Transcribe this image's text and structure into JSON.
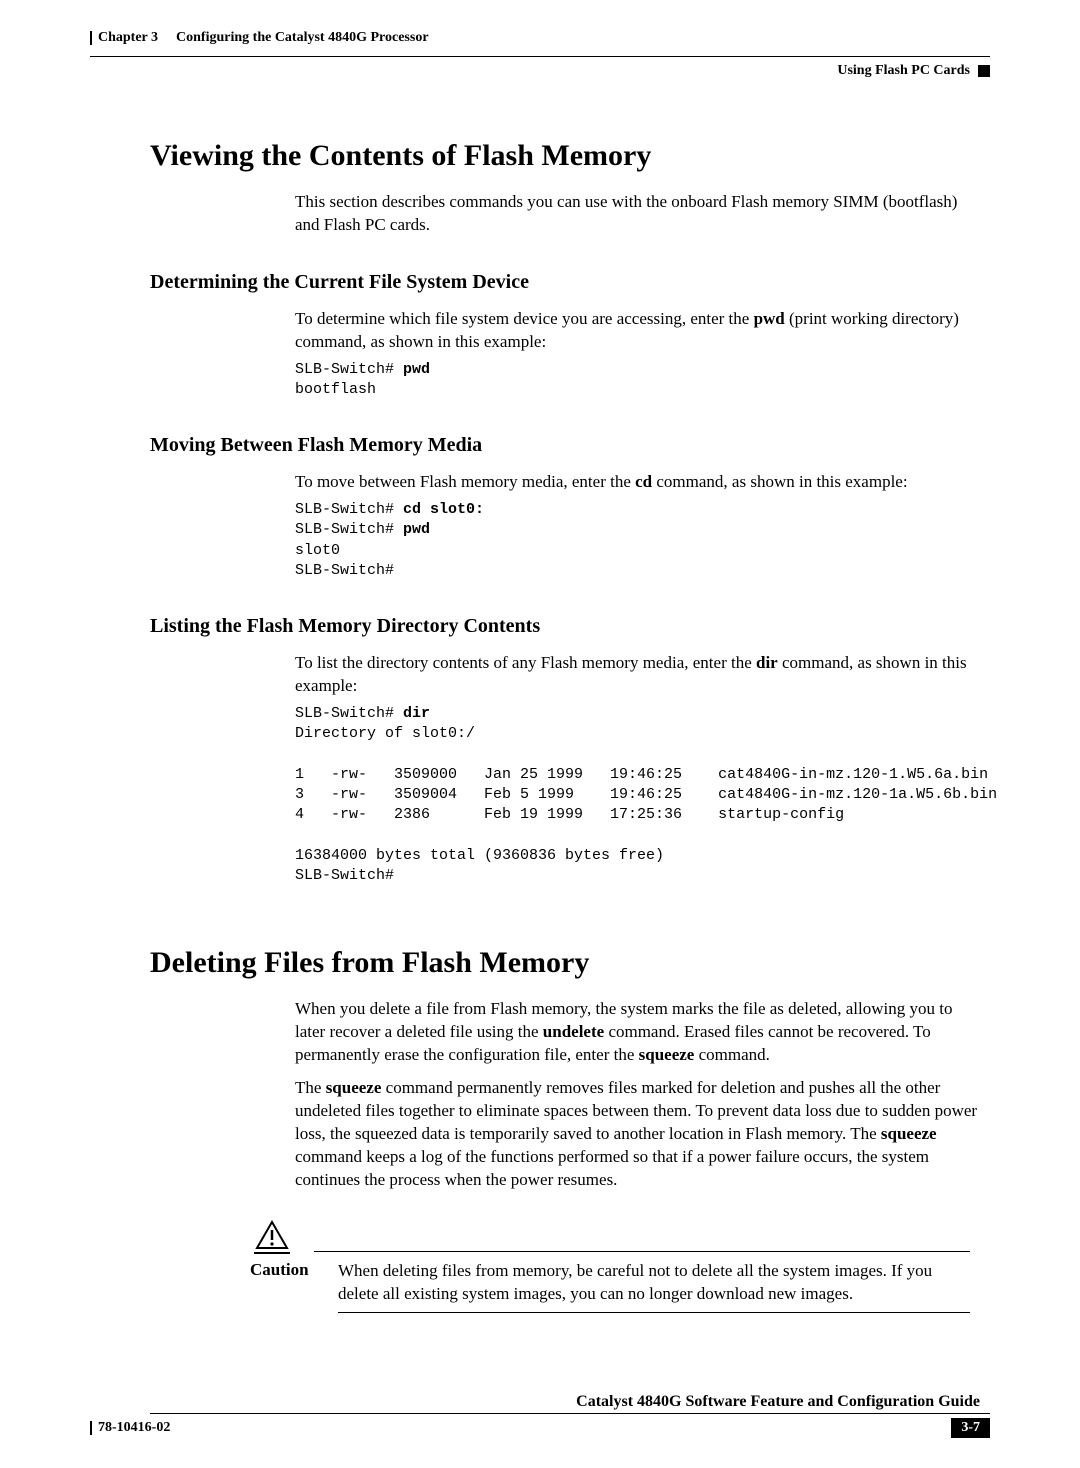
{
  "header": {
    "chapter_label": "Chapter 3",
    "chapter_title": "Configuring the Catalyst 4840G Processor",
    "right_label": "Using Flash PC Cards"
  },
  "s1": {
    "title": "Viewing the Contents of Flash Memory",
    "intro": "This section describes commands you can use with the onboard Flash memory SIMM (bootflash) and Flash PC cards."
  },
  "s1a": {
    "title": "Determining the Current File System Device",
    "p_pre": "To determine which file system device you are accessing, enter the ",
    "p_bold": "pwd",
    "p_post": " (print working directory) command, as shown in this example:",
    "cli_prompt1": "SLB-Switch# ",
    "cli_cmd1": "pwd",
    "cli_out1": "bootflash"
  },
  "s1b": {
    "title": "Moving Between Flash Memory Media",
    "p_pre": "To move between Flash memory media, enter the ",
    "p_bold": "cd",
    "p_post": " command, as shown in this example:",
    "cli_l1_prompt": "SLB-Switch# ",
    "cli_l1_cmd": "cd slot0:",
    "cli_l2_prompt": "SLB-Switch# ",
    "cli_l2_cmd": "pwd",
    "cli_l3": "slot0",
    "cli_l4": "SLB-Switch#"
  },
  "s1c": {
    "title": "Listing the Flash Memory Directory Contents",
    "p_pre": "To list the directory contents of any Flash memory media, enter the ",
    "p_bold": "dir",
    "p_post": " command, as shown in this example:",
    "cli_l1_prompt": "SLB-Switch# ",
    "cli_l1_cmd": "dir",
    "cli_l2": "Directory of slot0:/",
    "cli_blank": " ",
    "cli_r1": "1   -rw-   3509000   Jan 25 1999   19:46:25    cat4840G-in-mz.120-1.W5.6a.bin",
    "cli_r2": "3   -rw-   3509004   Feb 5 1999    19:46:25    cat4840G-in-mz.120-1a.W5.6b.bin",
    "cli_r3": "4   -rw-   2386      Feb 19 1999   17:25:36    startup-config",
    "cli_total": "16384000 bytes total (9360836 bytes free)",
    "cli_end": "SLB-Switch#"
  },
  "s2": {
    "title": "Deleting Files from Flash Memory",
    "p1_a": "When you delete a file from Flash memory, the system marks the file as deleted, allowing you to later recover a deleted file using the ",
    "p1_b1": "undelete",
    "p1_b": " command. Erased files cannot be recovered. To permanently erase the configuration file, enter the ",
    "p1_b2": "squeeze",
    "p1_c": " command.",
    "p2_a": "The ",
    "p2_b1": "squeeze",
    "p2_b": " command permanently removes files marked for deletion and pushes all the other undeleted files together to eliminate spaces between them. To prevent data loss due to sudden power loss, the squeezed data is temporarily saved to another location in Flash memory. The ",
    "p2_b2": "squeeze",
    "p2_c": " command keeps a log of the functions performed so that if a power failure occurs, the system continues the process when the power resumes."
  },
  "caution": {
    "label": "Caution",
    "text": "When deleting files from memory, be careful not to delete all the system images. If you delete all existing system images, you can no longer download new images."
  },
  "footer": {
    "guide_title": "Catalyst 4840G Software Feature and Configuration Guide",
    "doc_number": "78-10416-02",
    "page_number": "3-7"
  }
}
